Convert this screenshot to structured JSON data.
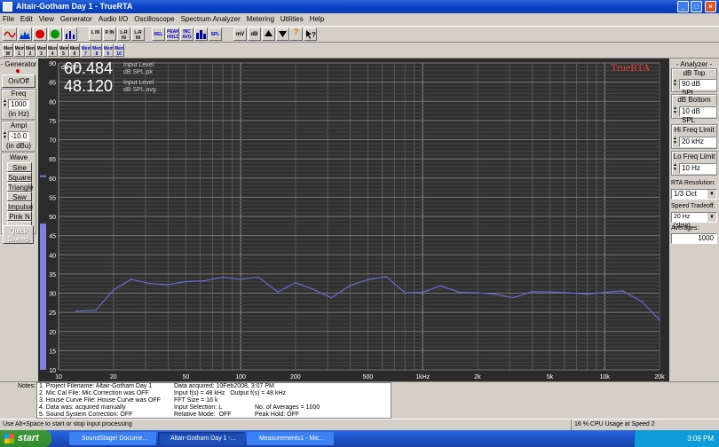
{
  "window": {
    "title": "Altair-Gotham Day 1 - TrueRTA",
    "min": "_",
    "max": "□",
    "close": "×"
  },
  "menu": [
    "File",
    "Edit",
    "View",
    "Generator",
    "Audio I/O",
    "Oscilloscope",
    "Spectrum Analyzer",
    "Metering",
    "Utilities",
    "Help"
  ],
  "toolbar1": [
    "REL",
    "PEAK HOLD",
    "INC AVG",
    "",
    "SPL",
    "",
    "mV",
    "dB",
    "",
    "",
    "?",
    ""
  ],
  "toolbar1_left": [
    "L IN",
    "R IN",
    "L-R IN",
    "L-R IN"
  ],
  "toolbar2": [
    "Mem W",
    "Mem 1",
    "Mem 2",
    "Mem 3",
    "Mem 4",
    "Mem 5",
    "Mem 6",
    "Mem 7",
    "Mem 8",
    "Mem 9",
    "Mem 10"
  ],
  "generator": {
    "title": "- Generator -",
    "onoff": "On/Off",
    "freq_label": "Freq",
    "freq_value": "1000",
    "freq_unit": "(in Hz)",
    "ampl_label": "Ampl",
    "ampl_value": "-10.0",
    "ampl_unit": "(in dBu)",
    "wave_label": "Wave",
    "waves": [
      "Sine",
      "Square",
      "Triangle",
      "Saw",
      "Impulse",
      "Pink N",
      "White N"
    ],
    "quick_sweep": "Quick Sweep"
  },
  "readout": {
    "value1": "60.484",
    "label1a": "Input Level",
    "label1b": "dB SPL pk",
    "value2": "48.120",
    "label2a": "Input Level",
    "label2b": "dB SPL avg"
  },
  "logo": "TrueRTA",
  "analyzer": {
    "title": "- Analyzer -",
    "db_top_label": "dB Top",
    "db_top_value": "90 dB SPL",
    "db_bottom_label": "dB Bottom",
    "db_bottom_value": "10 dB SPL",
    "hi_label": "Hi Freq Limit",
    "hi_value": "20 kHz",
    "lo_label": "Lo Freq Limit",
    "lo_value": "10 Hz",
    "rta_label": "RTA Resolution:",
    "rta_value": "1/3 Oct",
    "speed_label": "Speed Tradeoff:",
    "speed_value": "20 Hz (slow)",
    "avg_label": "Averages:",
    "avg_value": "1000"
  },
  "notes": {
    "label": "Notes:",
    "col1": [
      "1. Project Filename: Altair-Gotham Day 1",
      "2. Mic Cal File: Mic Correction was OFF",
      "3. House Curve File: House Curve was OFF",
      "4. Data was: acquired manually",
      "5. Sound System Correction: OFF"
    ],
    "col2": [
      "Data acquired: 10Feb2008, 3:07 PM",
      "Input f(s) = 48 kHz   Output f(s) = 48 kHz",
      "FFT Size = 16 k",
      "Input Selection: L",
      "Relative Mode:  OFF"
    ],
    "col3": [
      "",
      "",
      "",
      "No. of Averages = 1000",
      "Peak Hold: OFF"
    ]
  },
  "status": {
    "left": "Use Alt+Space to start or stop input processing",
    "cpu": "16 % CPU Usage at Speed 2"
  },
  "taskbar": {
    "start": "start",
    "tasks": [
      "SoundStage! Docume...",
      "Altair-Gotham Day 1 -...",
      "Measurements1 - Mic..."
    ],
    "clock": "3:09 PM"
  },
  "chart_data": {
    "type": "line",
    "ylabel": "dB SPL",
    "ylim": [
      10,
      90
    ],
    "xlim": [
      10,
      20000
    ],
    "log_x": true,
    "grid": true,
    "yticks": [
      90,
      85,
      80,
      75,
      70,
      65,
      60,
      55,
      50,
      45,
      40,
      35,
      30,
      25,
      20,
      15,
      10
    ],
    "xticks": [
      {
        "v": 10,
        "l": "10"
      },
      {
        "v": 20,
        "l": "20"
      },
      {
        "v": 50,
        "l": "50"
      },
      {
        "v": 100,
        "l": "100"
      },
      {
        "v": 200,
        "l": "200"
      },
      {
        "v": 500,
        "l": "500"
      },
      {
        "v": 1000,
        "l": "1kHz"
      },
      {
        "v": 2000,
        "l": "2k"
      },
      {
        "v": 5000,
        "l": "5k"
      },
      {
        "v": 10000,
        "l": "10k"
      },
      {
        "v": 20000,
        "l": "20k"
      }
    ],
    "series": [
      {
        "color": "#6a6ad8",
        "x": [
          12.5,
          16,
          20,
          25,
          31.5,
          40,
          50,
          63,
          80,
          100,
          125,
          160,
          200,
          250,
          315,
          400,
          500,
          630,
          800,
          1000,
          1250,
          1600,
          2000,
          2500,
          3150,
          4000,
          5000,
          6300,
          8000,
          10000,
          12500,
          16000,
          20000
        ],
        "y": [
          25.3,
          25.5,
          30.8,
          33.6,
          32.5,
          32.2,
          33,
          33.2,
          34.1,
          33.6,
          34.2,
          30.3,
          32.7,
          31,
          28.8,
          32,
          33.5,
          34.3,
          30.1,
          30.2,
          31.9,
          30.2,
          30.1,
          29.7,
          28.8,
          30.4,
          30.3,
          30.1,
          29.7,
          30.2,
          30.6,
          27.8,
          23
        ]
      }
    ],
    "peak_bar": {
      "peak": 60.484,
      "avg": 48.12,
      "color": "#8080e0"
    }
  }
}
